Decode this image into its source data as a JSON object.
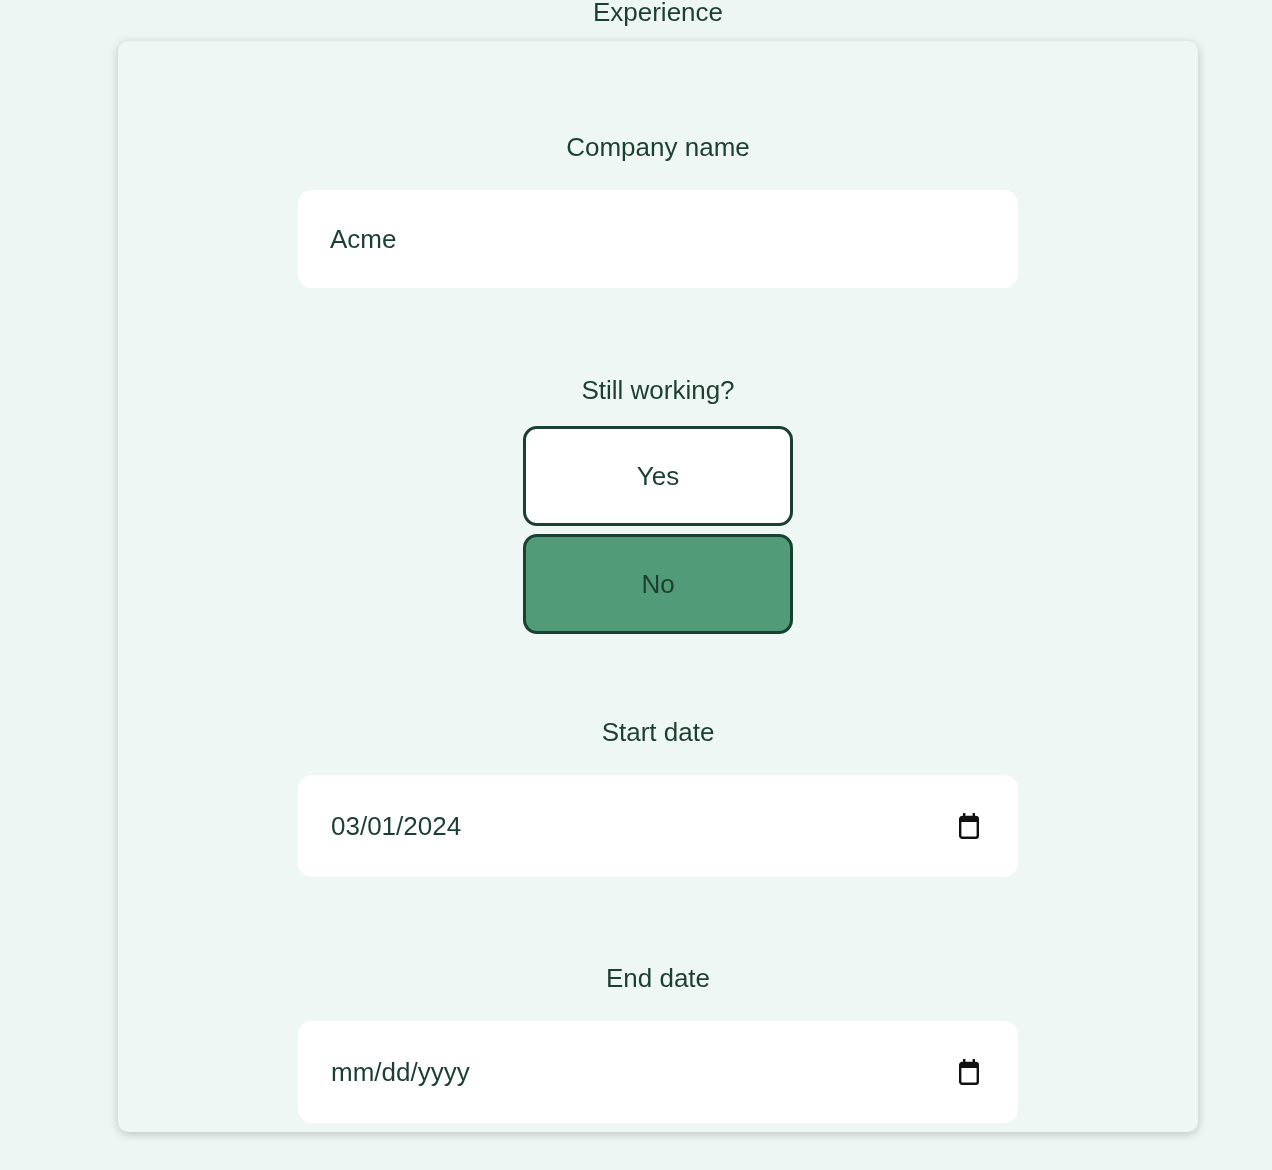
{
  "header": {
    "title": "Experience"
  },
  "fields": [
    {
      "kind": "text",
      "label": "Company name",
      "value": "Acme"
    },
    {
      "kind": "choice",
      "label": "Still working?",
      "options": [
        {
          "label": "Yes",
          "selected": false
        },
        {
          "label": "No",
          "selected": true
        }
      ]
    },
    {
      "kind": "date",
      "label": "Start date",
      "value": "03/01/2024"
    },
    {
      "kind": "date",
      "label": "End date",
      "placeholder": "mm/dd/yyyy"
    }
  ]
}
